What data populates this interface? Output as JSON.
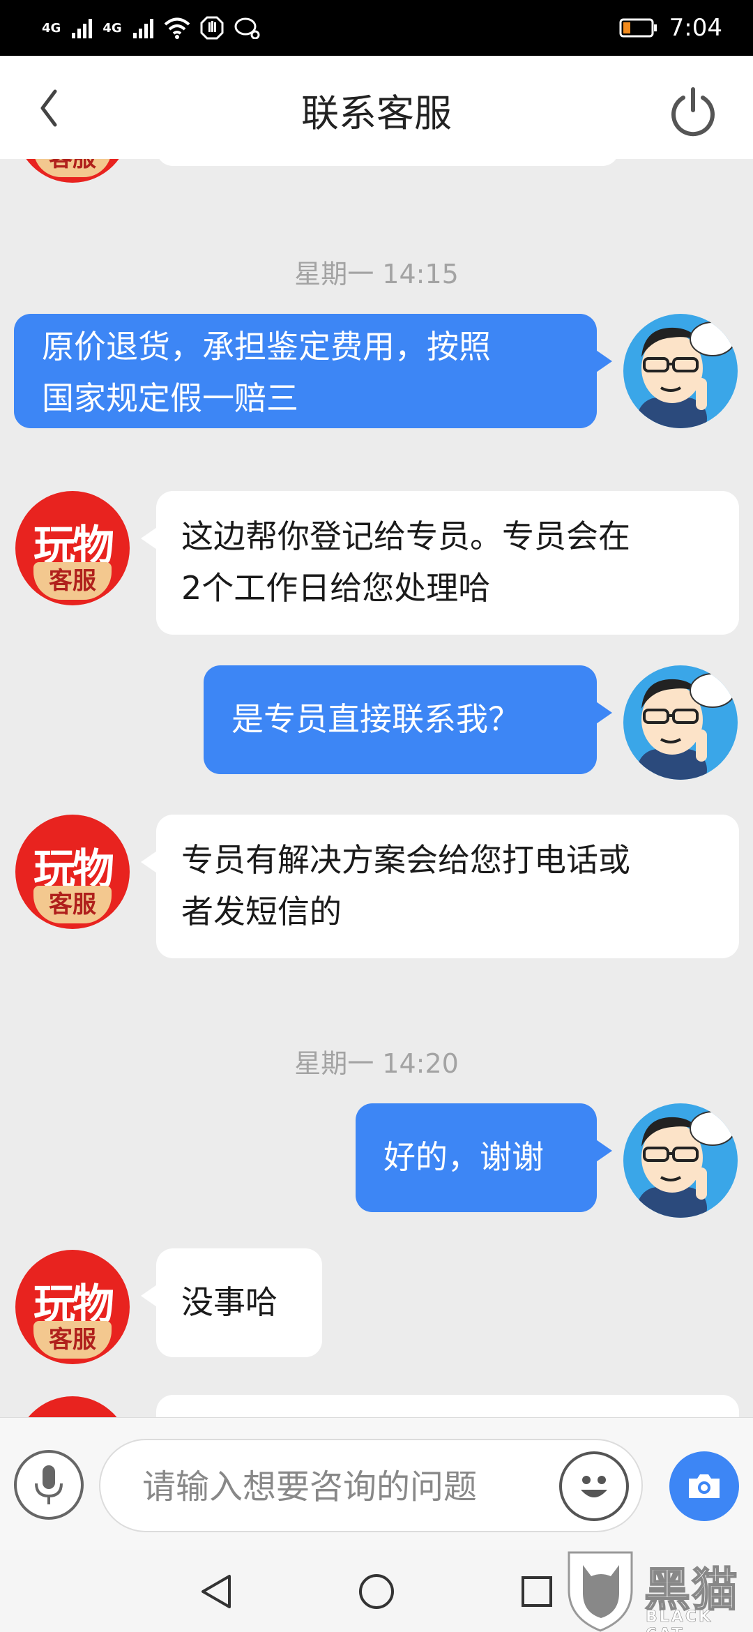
{
  "status_bar": {
    "network_1": "4G",
    "network_2": "4G",
    "time": "7:04"
  },
  "header": {
    "title": "联系客服"
  },
  "agent_avatar": {
    "text_top": "玩物",
    "text_bottom": "客服"
  },
  "chat": {
    "timestamps": [
      "星期一 14:15",
      "星期一 14:20"
    ],
    "messages": [
      {
        "from": "user",
        "lines": [
          "原价退货，承担鉴定费用，按照",
          "国家规定假一赔三"
        ]
      },
      {
        "from": "agent",
        "lines": [
          "这边帮你登记给专员。专员会在",
          "2个工作日给您处理哈"
        ]
      },
      {
        "from": "user",
        "lines": [
          "是专员直接联系我？"
        ]
      },
      {
        "from": "agent",
        "lines": [
          "专员有解决方案会给您打电话或",
          "者发短信的"
        ]
      },
      {
        "from": "user",
        "lines": [
          "好的，谢谢"
        ]
      },
      {
        "from": "agent",
        "lines": [
          "没事哈"
        ]
      }
    ]
  },
  "input": {
    "placeholder": "请输入想要咨询的问题"
  },
  "watermark": {
    "cn": "黑猫",
    "en": "BLACK CAT"
  },
  "colors": {
    "user_bubble": "#3d86f5",
    "agent_bubble": "#ffffff",
    "chat_background": "#ececec",
    "agent_avatar": "#e8231f"
  }
}
